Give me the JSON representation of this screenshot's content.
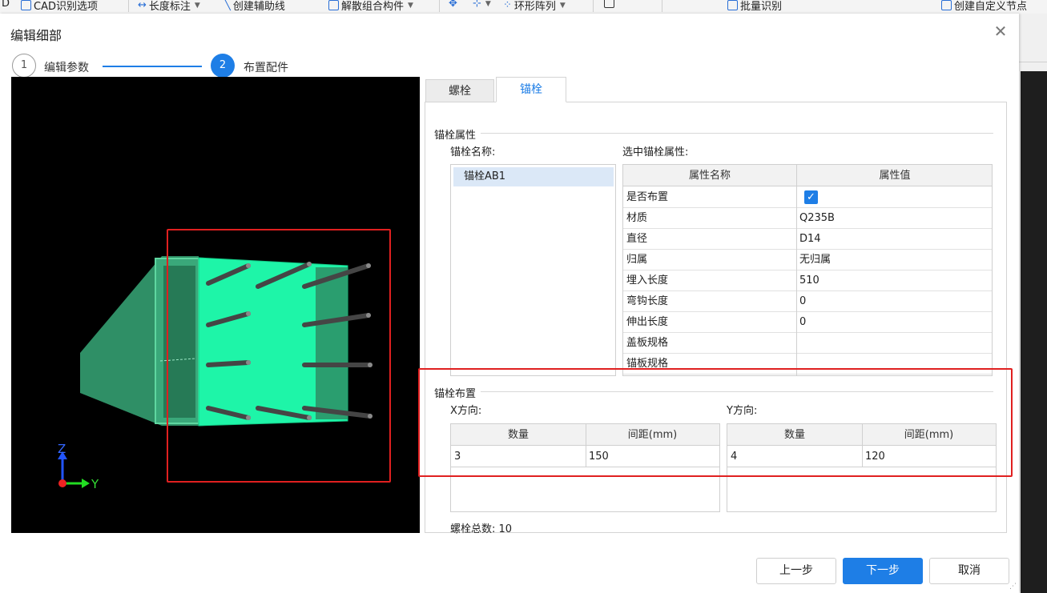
{
  "toolbar": {
    "items": [
      {
        "label": "D",
        "icon": "none"
      },
      {
        "label": "CAD识别选项",
        "icon": "cad-options-icon"
      },
      {
        "label": "长度标注",
        "icon": "dimension-icon",
        "dropdown": true
      },
      {
        "label": "创建辅助线",
        "icon": "aux-line-icon"
      },
      {
        "label": "解散组合构件",
        "icon": "ungroup-icon",
        "dropdown": true
      },
      {
        "label": "",
        "icon": "move-icon"
      },
      {
        "label": "",
        "icon": "align-icon",
        "dropdown": true
      },
      {
        "label": "环形阵列",
        "icon": "ring-array-icon",
        "dropdown": true
      },
      {
        "label": "",
        "icon": "rect-icon"
      },
      {
        "label": "批量识别",
        "icon": "batch-recognize-icon"
      },
      {
        "label": "创建自定义节点",
        "icon": "custom-node-icon"
      }
    ]
  },
  "dialog": {
    "title": "编辑细部",
    "close_glyph": "✕",
    "steps": [
      {
        "number": "1",
        "label": "编辑参数",
        "state": "done"
      },
      {
        "number": "2",
        "label": "布置配件",
        "state": "active"
      }
    ]
  },
  "viewport": {
    "axis_z": "Z",
    "axis_y": "Y",
    "colors": {
      "background": "#000000",
      "plate": "#1ef5a8",
      "body": "#2f8f66",
      "bolt": "#4a4a4a"
    }
  },
  "tabs": [
    {
      "label": "螺栓",
      "active": false
    },
    {
      "label": "锚栓",
      "active": true
    }
  ],
  "anchor_props": {
    "group_title": "锚栓属性",
    "name_label": "锚栓名称:",
    "selected_label": "选中锚栓属性:",
    "names": [
      "锚栓AB1"
    ],
    "columns": [
      "属性名称",
      "属性值"
    ],
    "rows": [
      {
        "name": "是否布置",
        "value": "",
        "checked": true
      },
      {
        "name": "材质",
        "value": "Q235B"
      },
      {
        "name": "直径",
        "value": "D14"
      },
      {
        "name": "归属",
        "value": "无归属"
      },
      {
        "name": "埋入长度",
        "value": "510"
      },
      {
        "name": "弯钩长度",
        "value": "0"
      },
      {
        "name": "伸出长度",
        "value": "0"
      },
      {
        "name": "盖板规格",
        "value": ""
      },
      {
        "name": "锚板规格",
        "value": ""
      }
    ]
  },
  "layout_group": {
    "group_title": "锚栓布置",
    "x_label": "X方向:",
    "y_label": "Y方向:",
    "columns": [
      "数量",
      "间距(mm)"
    ],
    "x_row": {
      "count": "3",
      "spacing": "150"
    },
    "y_row": {
      "count": "4",
      "spacing": "120"
    },
    "total_label": "螺栓总数:",
    "total_value": "10"
  },
  "buttons": {
    "prev": "上一步",
    "next": "下一步",
    "cancel": "取消"
  },
  "accent_color": "#1e7ee6",
  "highlight_color": "#e02020"
}
